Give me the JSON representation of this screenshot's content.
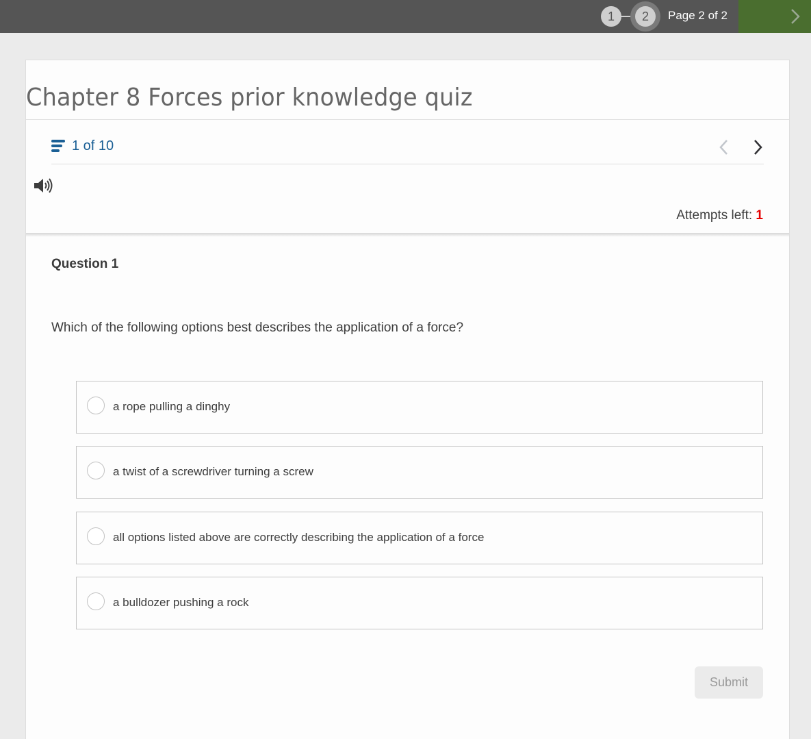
{
  "topbar": {
    "steps": [
      {
        "label": "1",
        "state": "completed"
      },
      {
        "label": "2",
        "state": "current"
      }
    ],
    "page_indicator": "Page 2 of 2",
    "next_icon": "chevron-right-icon",
    "colors": {
      "bar": "#555555",
      "next_button": "#4a6e2f"
    }
  },
  "quiz": {
    "title": "Chapter 8 Forces prior knowledge quiz",
    "question_nav": {
      "list_icon": "question-list-icon",
      "count": "1 of 10",
      "prev_icon": "chevron-left-icon",
      "next_icon": "chevron-right-icon"
    },
    "audio_icon": "speaker-icon",
    "attempts": {
      "label": "Attempts left:",
      "value": "1",
      "value_color": "#e60000"
    },
    "question": {
      "title": "Question 1",
      "text": "Which of the following options best describes the application of a force?",
      "options": [
        {
          "label": "a rope pulling a dinghy",
          "selected": false
        },
        {
          "label": "a twist of a screwdriver turning a screw",
          "selected": false
        },
        {
          "label": "all options listed above are correctly describing the application of a force",
          "selected": false
        },
        {
          "label": "a bulldozer pushing a rock",
          "selected": false
        }
      ]
    },
    "submit_label": "Submit",
    "submit_enabled": false
  }
}
